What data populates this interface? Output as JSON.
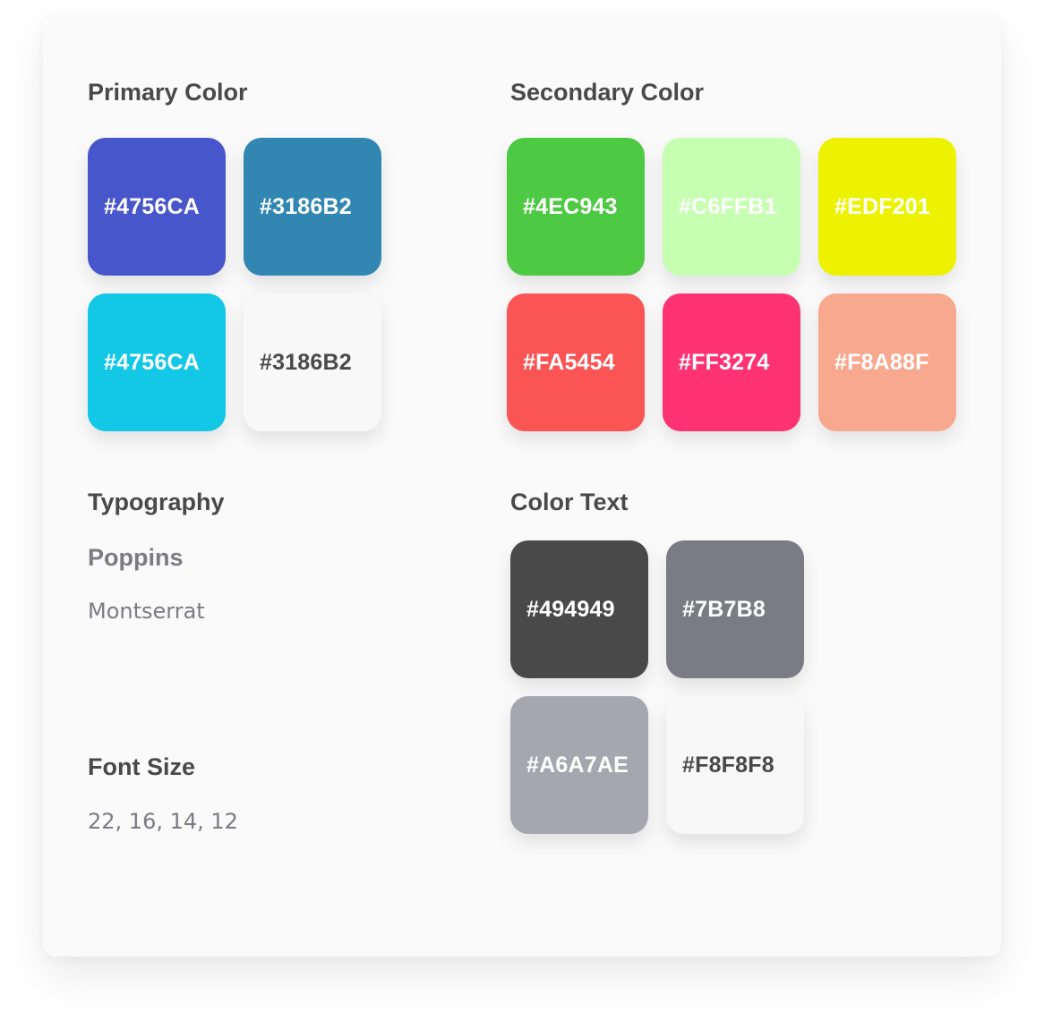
{
  "primary": {
    "title": "Primary Color",
    "swatches": [
      {
        "label": "#4756CA",
        "bg": "#4756CA",
        "fg": "#ffffff"
      },
      {
        "label": "#3186B2",
        "bg": "#3186B2",
        "fg": "#ffffff"
      },
      {
        "label": "#4756CA",
        "bg": "#12C8E6",
        "fg": "#ffffff"
      },
      {
        "label": "#3186B2",
        "bg": "#F8F8F8",
        "fg": "#494949"
      }
    ]
  },
  "secondary": {
    "title": "Secondary Color",
    "swatches": [
      {
        "label": "#4EC943",
        "bg": "#4EC943",
        "fg": "#ffffff"
      },
      {
        "label": "#C6FFB1",
        "bg": "#C6FFB1",
        "fg": "#ffffff"
      },
      {
        "label": "#EDF201",
        "bg": "#EDF201",
        "fg": "#ffffff"
      },
      {
        "label": "#FA5454",
        "bg": "#FA5454",
        "fg": "#ffffff"
      },
      {
        "label": "#FF3274",
        "bg": "#FF3274",
        "fg": "#ffffff"
      },
      {
        "label": "#F8A88F",
        "bg": "#F8A88F",
        "fg": "#ffffff"
      }
    ]
  },
  "typography": {
    "title": "Typography",
    "primary_font": "Poppins",
    "secondary_font": "Montserrat"
  },
  "font_size": {
    "title": "Font Size",
    "values": "22, 16, 14, 12"
  },
  "color_text": {
    "title": "Color Text",
    "swatches": [
      {
        "label": "#494949",
        "bg": "#494949",
        "fg": "#ffffff"
      },
      {
        "label": "#7B7B8",
        "bg": "#7B7B84",
        "fg": "#ffffff"
      },
      {
        "label": "#A6A7AE",
        "bg": "#A6A7AE",
        "fg": "#ffffff"
      },
      {
        "label": "#F8F8F8",
        "bg": "#F8F8F8",
        "fg": "#494949"
      }
    ]
  }
}
